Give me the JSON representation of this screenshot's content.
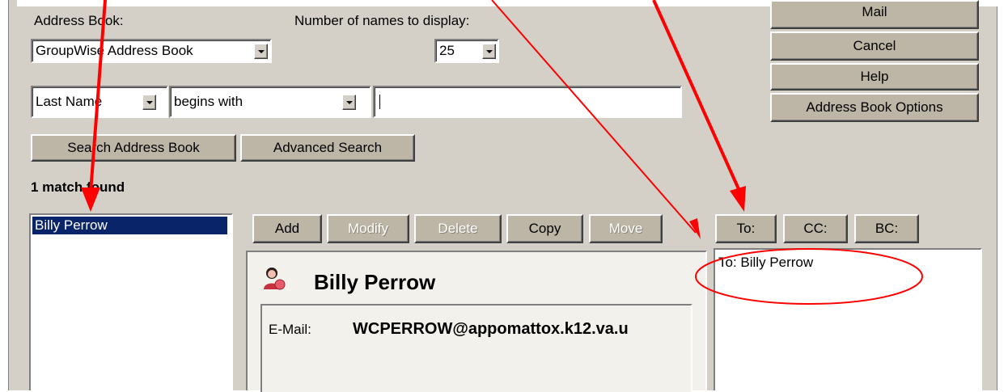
{
  "address_book": {
    "label": "Address Book:",
    "selected": "GroupWise Address Book"
  },
  "display_count": {
    "label": "Number of names to display:",
    "selected": "25"
  },
  "search": {
    "field": "Last Name",
    "operator": "begins with",
    "value": "",
    "search_button": "Search Address Book",
    "advanced_button": "Advanced Search"
  },
  "right_buttons": {
    "mail": "Mail",
    "cancel": "Cancel",
    "help": "Help",
    "options": "Address Book Options"
  },
  "results": {
    "status": "1 match found",
    "items": [
      "Billy Perrow"
    ]
  },
  "entry_toolbar": {
    "add": "Add",
    "modify": "Modify",
    "delete": "Delete",
    "copy": "Copy",
    "move": "Move"
  },
  "contact": {
    "name": "Billy Perrow",
    "email_label": "E-Mail:",
    "email_value": "WCPERROW@appomattox.k12.va.u",
    "icon": "person-icon"
  },
  "recipient_buttons": {
    "to": "To:",
    "cc": "CC:",
    "bc": "BC:"
  },
  "recipients": {
    "items": [
      "To: Billy Perrow"
    ]
  },
  "colors": {
    "annotation": "#ff0000",
    "selection": "#0a246a",
    "dialog_bg": "#d4d0c8"
  }
}
